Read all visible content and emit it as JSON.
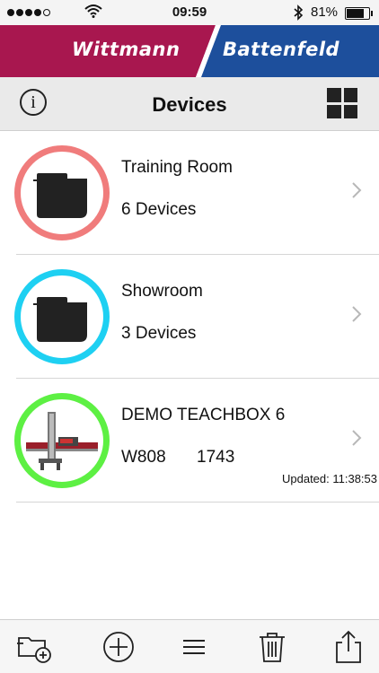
{
  "status_bar": {
    "time": "09:59",
    "battery_percent": "81%",
    "battery_level": 0.81,
    "signal_bars": 4
  },
  "brand": {
    "left_name": "Wittmann",
    "right_name": "Battenfeld",
    "left_color": "#a8174f",
    "right_color": "#1d4f9c"
  },
  "header": {
    "title": "Devices",
    "info_glyph": "i",
    "info_icon": "info-circle-icon",
    "grid_icon": "grid-icon"
  },
  "devices": [
    {
      "title": "Training Room",
      "subtitle": "6 Devices",
      "subtitle2": "",
      "ring_color": "#f07c7c",
      "icon": "folder-icon"
    },
    {
      "title": "Showroom",
      "subtitle": "3 Devices",
      "subtitle2": "",
      "ring_color": "#1ed0f2",
      "icon": "folder-icon"
    },
    {
      "title": "DEMO TEACHBOX 6",
      "subtitle": "W808",
      "subtitle2": "1743",
      "ring_color": "#5df043",
      "icon": "robot-image",
      "updated": "Updated: 11:38:53"
    }
  ],
  "toolbar": {
    "icons": [
      "add-folder-icon",
      "add-circle-icon",
      "menu-icon",
      "trash-icon",
      "share-icon"
    ]
  }
}
